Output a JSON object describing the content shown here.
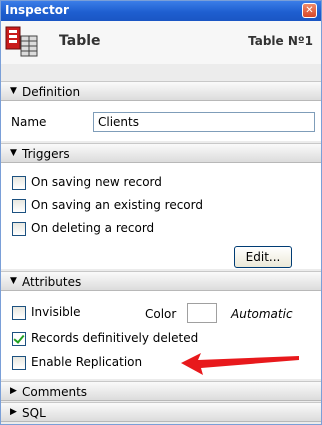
{
  "window": {
    "title": "Inspector"
  },
  "header": {
    "name": "Table",
    "identifier": "Table Nº1",
    "icon": "table-icon"
  },
  "sections": {
    "definition": "Definition",
    "triggers": "Triggers",
    "attributes": "Attributes",
    "comments": "Comments",
    "sql": "SQL"
  },
  "definition": {
    "name_label": "Name",
    "name_value": "Clients"
  },
  "triggers": {
    "items": [
      {
        "label": "On saving new record",
        "checked": false
      },
      {
        "label": "On saving an existing record",
        "checked": false
      },
      {
        "label": "On deleting a record",
        "checked": false
      }
    ],
    "edit_button": "Edit..."
  },
  "attributes": {
    "invisible": "Invisible",
    "color_label": "Color",
    "color_value": "Automatic",
    "records_deleted": "Records definitively deleted",
    "enable_replication": "Enable Replication"
  },
  "colors": {
    "titlebar": "#1e5fd0",
    "annotation_arrow": "#e8191c",
    "check": "#21a121"
  }
}
